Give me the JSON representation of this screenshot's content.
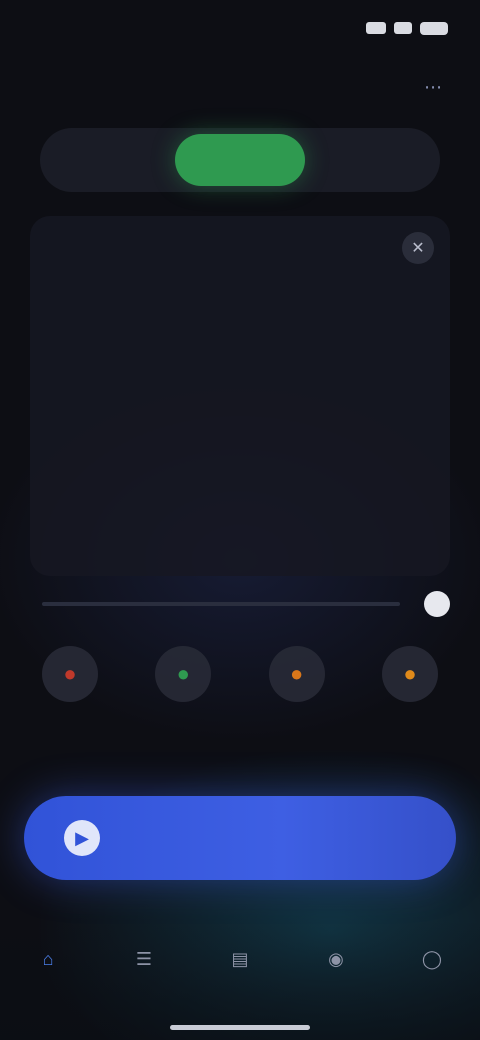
{
  "status": {
    "time": "",
    "icons": [
      "signal-icon",
      "wifi-icon",
      "battery-icon"
    ]
  },
  "header": {
    "title": "",
    "action_icon": "more-icon"
  },
  "tabs": [
    {
      "label": "",
      "active": false
    },
    {
      "label": "",
      "active": true
    },
    {
      "label": "",
      "active": false
    }
  ],
  "card": {
    "close_icon": "close-icon",
    "sections": [
      {
        "label": "",
        "text": "",
        "sub": ""
      },
      {
        "label": "",
        "text": "",
        "sub": ""
      }
    ]
  },
  "progress": {
    "left": "",
    "right": "",
    "fraction": 0.0
  },
  "quick_actions": [
    {
      "label": "",
      "icon": "red-circle-icon",
      "color": "#c0392b"
    },
    {
      "label": "",
      "icon": "green-circle-icon",
      "color": "#2f9a50"
    },
    {
      "label": "",
      "icon": "orange-circle-icon",
      "color": "#d9771a"
    },
    {
      "label": "",
      "icon": "amber-circle-icon",
      "color": "#e08a1a"
    }
  ],
  "primary_button": {
    "label": "",
    "icon": "play-icon",
    "color": "#3153d8"
  },
  "bottom_nav": [
    {
      "label": "",
      "icon": "home-icon",
      "active": true
    },
    {
      "label": "",
      "icon": "list-icon",
      "active": false
    },
    {
      "label": "",
      "icon": "chart-icon",
      "active": false
    },
    {
      "label": "",
      "icon": "chat-icon",
      "active": false
    },
    {
      "label": "",
      "icon": "profile-icon",
      "active": false
    }
  ],
  "colors": {
    "background": "#0d0e14",
    "accent_green": "#2f9a50",
    "accent_blue": "#3153d8",
    "section_label": "#4d7fe0"
  }
}
